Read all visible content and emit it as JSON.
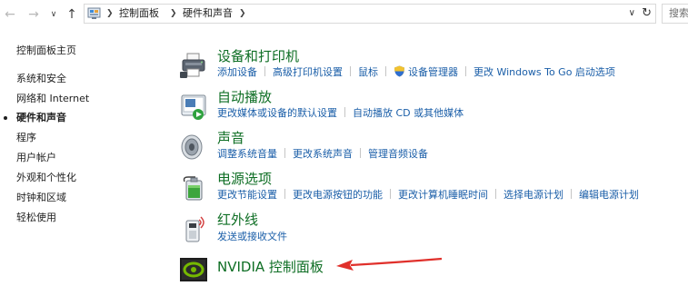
{
  "addressbar": {
    "back_icon": "arrow-left-icon",
    "forward_icon": "arrow-right-icon",
    "recent_icon": "chevron-down-icon",
    "up_icon": "arrow-up-icon",
    "crumbs": [
      "控制面板",
      "硬件和声音"
    ],
    "search_placeholder": "搜索控制面板"
  },
  "sidebar": {
    "items": [
      {
        "label": "控制面板主页"
      },
      {
        "label": "系统和安全"
      },
      {
        "label": "网络和 Internet"
      },
      {
        "label": "硬件和声音"
      },
      {
        "label": "程序"
      },
      {
        "label": "用户帐户"
      },
      {
        "label": "外观和个性化"
      },
      {
        "label": "时钟和区域"
      },
      {
        "label": "轻松使用"
      }
    ]
  },
  "categories": [
    {
      "title": "设备和打印机",
      "icon": "printer-icon",
      "links": [
        "添加设备",
        "高级打印机设置",
        "鼠标",
        "设备管理器",
        "更改 Windows To Go 启动选项"
      ]
    },
    {
      "title": "自动播放",
      "icon": "autoplay-icon",
      "links": [
        "更改媒体或设备的默认设置",
        "自动播放 CD 或其他媒体"
      ]
    },
    {
      "title": "声音",
      "icon": "speaker-icon",
      "links": [
        "调整系统音量",
        "更改系统声音",
        "管理音频设备"
      ]
    },
    {
      "title": "电源选项",
      "icon": "battery-icon",
      "links": [
        "更改节能设置",
        "更改电源按钮的功能",
        "更改计算机睡眠时间",
        "选择电源计划",
        "编辑电源计划"
      ]
    },
    {
      "title": "红外线",
      "icon": "infrared-icon",
      "links": [
        "发送或接收文件"
      ]
    },
    {
      "title": "NVIDIA 控制面板",
      "icon": "nvidia-icon",
      "links": []
    }
  ],
  "colors": {
    "category_title": "#0e6e24",
    "link": "#1a5ea8",
    "annotation_arrow": "#e0302b"
  }
}
